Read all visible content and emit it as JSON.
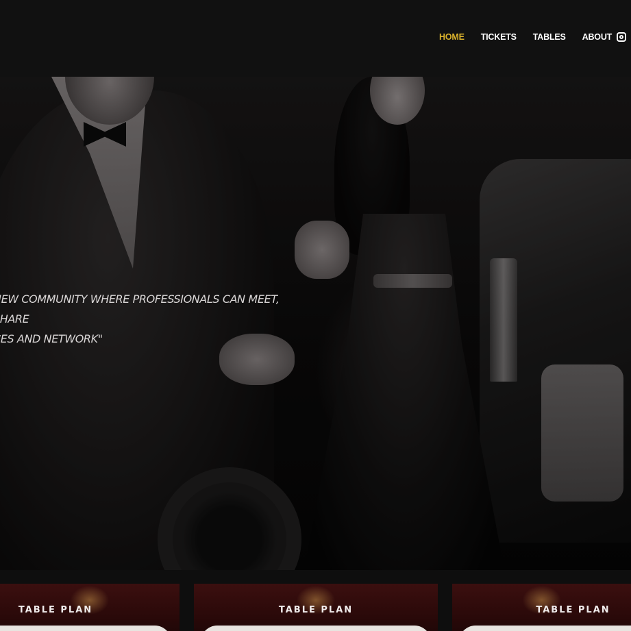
{
  "nav": {
    "items": [
      {
        "label": "HOME",
        "active": true
      },
      {
        "label": "TICKETS",
        "active": false
      },
      {
        "label": "TABLES",
        "active": false
      },
      {
        "label": "ABOUT",
        "active": false
      }
    ],
    "social_icon": "instagram-icon"
  },
  "hero": {
    "quote": "NEW COMMUNITY WHERE PROFESSIONALS CAN MEET, SHARE\nCES AND NETWORK\""
  },
  "cards": [
    {
      "label": "TABLE PLAN"
    },
    {
      "label": "TABLE PLAN"
    },
    {
      "label": "TABLE PLAN"
    }
  ],
  "colors": {
    "header_bg": "#111111",
    "accent": "#d9b12c",
    "nav_text": "#ffffff",
    "card_bg": "#3b0f0f"
  }
}
